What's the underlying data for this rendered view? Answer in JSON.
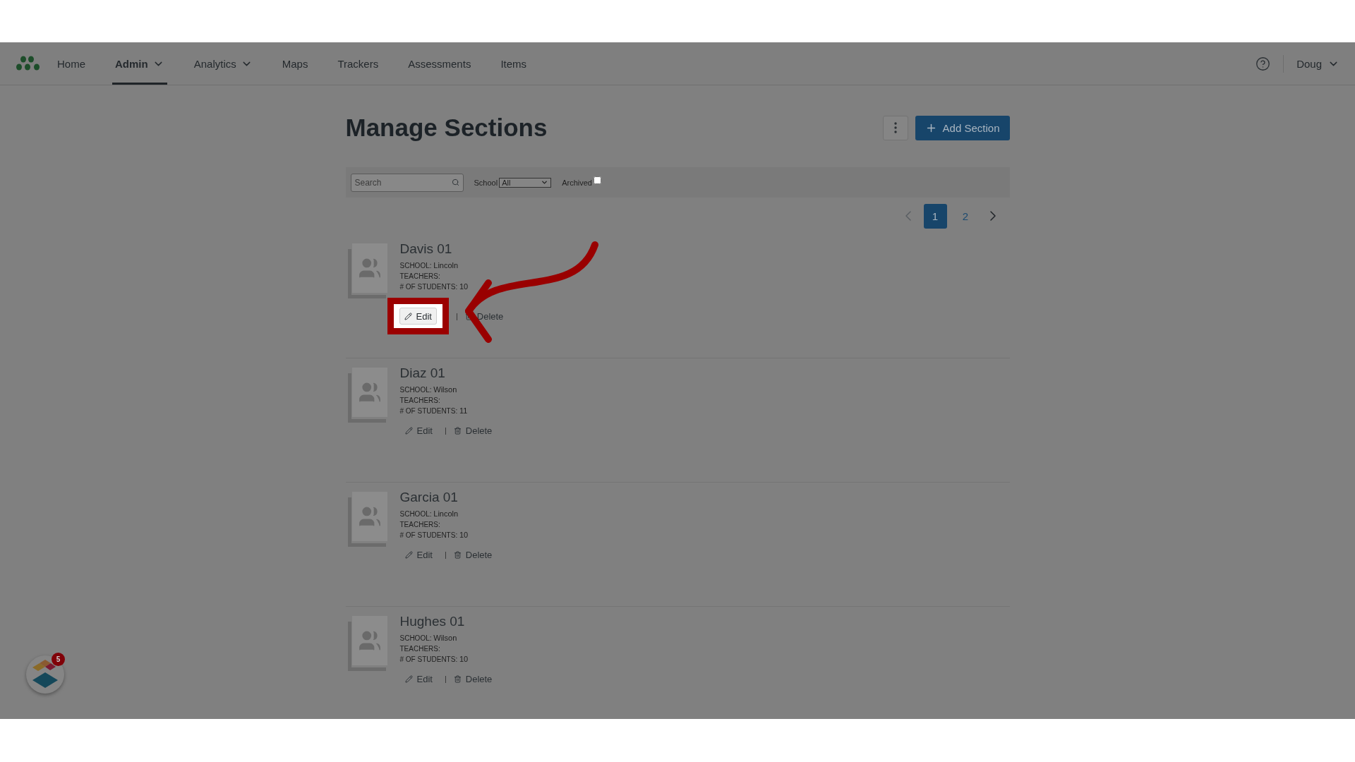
{
  "nav": {
    "items": [
      {
        "label": "Home",
        "selected": false,
        "dropdown": false
      },
      {
        "label": "Admin",
        "selected": true,
        "dropdown": true
      },
      {
        "label": "Analytics",
        "selected": false,
        "dropdown": true
      },
      {
        "label": "Maps",
        "selected": false,
        "dropdown": false
      },
      {
        "label": "Trackers",
        "selected": false,
        "dropdown": false
      },
      {
        "label": "Assessments",
        "selected": false,
        "dropdown": false
      },
      {
        "label": "Items",
        "selected": false,
        "dropdown": false
      }
    ],
    "user": "Doug"
  },
  "page": {
    "title": "Manage Sections",
    "add_button": "Add Section"
  },
  "filters": {
    "search_placeholder": "Search",
    "school_label": "School",
    "school_value": "All",
    "archived_label": "Archived",
    "archived_checked": false
  },
  "pagination": {
    "pages": [
      {
        "label": "1",
        "selected": true
      },
      {
        "label": "2",
        "selected": false
      }
    ]
  },
  "sections": [
    {
      "name": "Davis 01",
      "school_label": "SCHOOL:",
      "school": "Lincoln",
      "teachers_label": "TEACHERS:",
      "students_label": "# OF STUDENTS:",
      "students": "10",
      "edit": "Edit",
      "separator": "|",
      "delete": "Delete",
      "highlighted": true
    },
    {
      "name": "Diaz 01",
      "school_label": "SCHOOL:",
      "school": "Wilson",
      "teachers_label": "TEACHERS:",
      "students_label": "# OF STUDENTS:",
      "students": "11",
      "edit": "Edit",
      "separator": "|",
      "delete": "Delete",
      "highlighted": false
    },
    {
      "name": "Garcia 01",
      "school_label": "SCHOOL:",
      "school": "Lincoln",
      "teachers_label": "TEACHERS:",
      "students_label": "# OF STUDENTS:",
      "students": "10",
      "edit": "Edit",
      "separator": "|",
      "delete": "Delete",
      "highlighted": false
    },
    {
      "name": "Hughes 01",
      "school_label": "SCHOOL:",
      "school": "Wilson",
      "teachers_label": "TEACHERS:",
      "students_label": "# OF STUDENTS:",
      "students": "10",
      "edit": "Edit",
      "separator": "|",
      "delete": "Delete",
      "highlighted": false
    }
  ],
  "widget": {
    "badge": "5"
  }
}
